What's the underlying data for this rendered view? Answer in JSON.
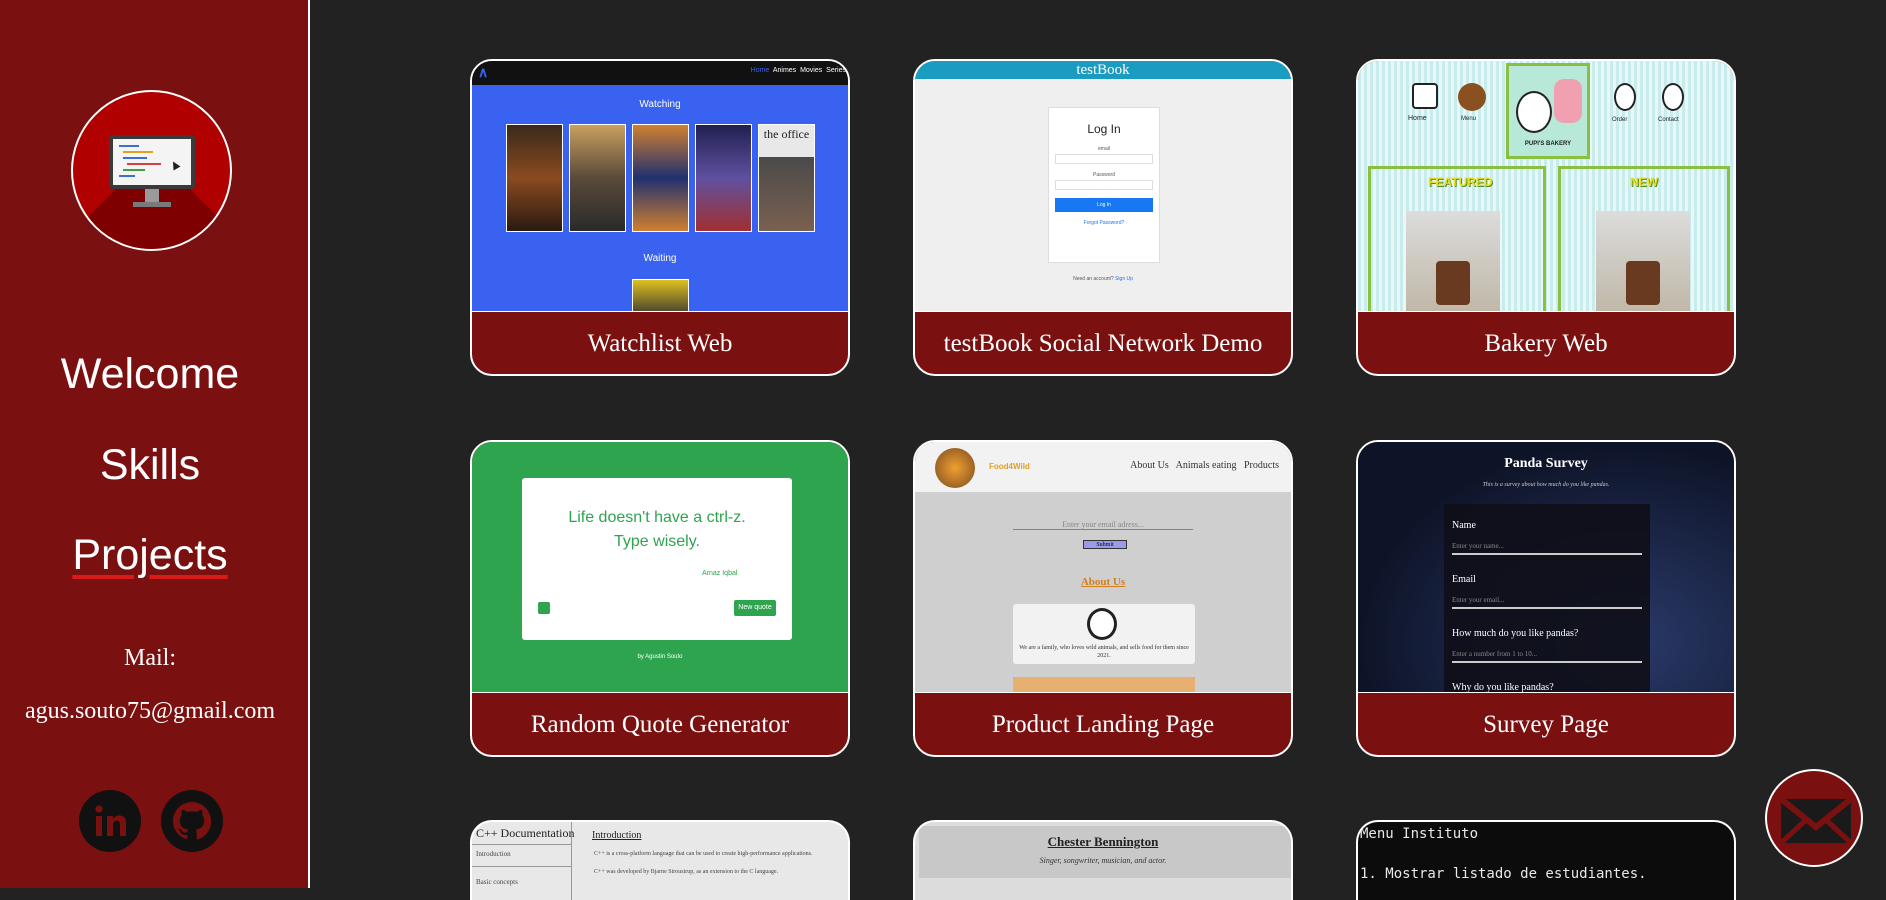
{
  "sidebar": {
    "nav": [
      "Welcome",
      "Skills",
      "Projects"
    ],
    "mail_label": "Mail:",
    "mail_address": "agus.souto75@gmail.com"
  },
  "projects": [
    {
      "title": "Watchlist Web"
    },
    {
      "title": "testBook Social Network Demo"
    },
    {
      "title": "Bakery Web"
    },
    {
      "title": "Random Quote Generator"
    },
    {
      "title": "Product Landing Page"
    },
    {
      "title": "Survey Page"
    }
  ],
  "previews": {
    "watchlist": {
      "nav": [
        "Home",
        "Animes",
        "Movies",
        "Series"
      ],
      "watching": "Watching",
      "waiting": "Waiting",
      "office": "the office"
    },
    "testbook": {
      "brand": "testBook",
      "login_title": "Log In",
      "email": "email",
      "password": "Password",
      "button": "Log In",
      "forgot": "Forgot Password?",
      "signup_q": "Need an account?",
      "signup": "Sign Up"
    },
    "bakery": {
      "nav": [
        "Home",
        "Menu",
        "Order",
        "Contact"
      ],
      "brand": "PUPI'S BAKERY",
      "featured": "FEATURED",
      "new": "NEW"
    },
    "quote": {
      "text": "Life doesn't have a ctrl-z. Type wisely.",
      "author": "Arnaz Iqbal",
      "button": "New quote",
      "footer": "by Agustin Souto"
    },
    "landing": {
      "logo": "Food4Wild",
      "nav": [
        "About Us",
        "Animals eating",
        "Products"
      ],
      "email_placeholder": "Enter your email adress...",
      "submit": "Submit",
      "about": "About Us",
      "about_text": "We are a family, who loves wild animals, and sells food for them since 2021."
    },
    "survey": {
      "title": "Panda Survey",
      "subtitle": "This is a survey about how much do you like pandas.",
      "fields": [
        {
          "label": "Name",
          "placeholder": "Enter your name..."
        },
        {
          "label": "Email",
          "placeholder": "Enter your email..."
        },
        {
          "label": "How much do you like pandas?",
          "placeholder": "Enter a number from 1 to 10..."
        }
      ],
      "next": "Why do you like pandas?"
    },
    "docs": {
      "title": "C++ Documentation",
      "items": [
        "Introduction",
        "Basic concepts"
      ],
      "heading": "Introduction",
      "line1": "C++ is a cross-platform language that can be used to create high-performance applications.",
      "line2": "C++ was developed by Bjarne Stroustrup, as an extension to the C language."
    },
    "tribute": {
      "name": "Chester Bennington",
      "sub": "Singer, songwriter, musician, and actor."
    },
    "terminal": {
      "line1": "Menu Instituto",
      "line2": "1. Mostrar listado de estudiantes."
    }
  },
  "colors": {
    "sidebar": "#7a1010",
    "background": "#222222",
    "accent": "#d91a1a"
  },
  "icons": [
    "monitor-code-icon",
    "linkedin-icon",
    "github-icon",
    "mail-icon"
  ]
}
